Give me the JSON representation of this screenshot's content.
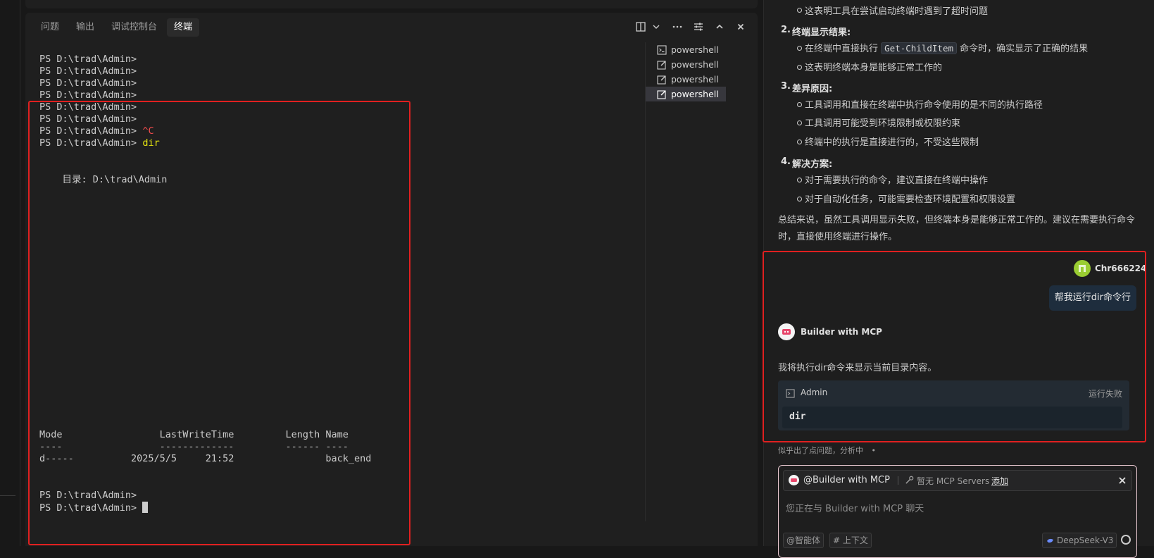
{
  "panel": {
    "tabs": [
      "问题",
      "输出",
      "调试控制台",
      "终端"
    ],
    "active_tab": "终端"
  },
  "terminal": {
    "lines": [
      "PS D:\\trad\\Admin>",
      "PS D:\\trad\\Admin>",
      "PS D:\\trad\\Admin>",
      "PS D:\\trad\\Admin>",
      "PS D:\\trad\\Admin>",
      "PS D:\\trad\\Admin>"
    ],
    "prompt": "PS D:\\trad\\Admin>",
    "ctrl_c": "^C",
    "dir_cmd": "dir",
    "directory_line": "    目录: D:\\trad\\Admin",
    "header": "Mode                 LastWriteTime         Length Name",
    "separator": "----                 -------------         ------ ----",
    "row": "d-----          2025/5/5     21:52                back_end",
    "final_prompts": [
      "PS D:\\trad\\Admin>",
      "PS D:\\trad\\Admin>"
    ]
  },
  "terminal_list": [
    "powershell",
    "powershell",
    "powershell",
    "powershell"
  ],
  "chat": {
    "prev_bullet_1": "这表明工具在尝试启动终端时遇到了超时问题",
    "section2_num": "2.",
    "section2_title": "终端显示结果:",
    "s2_b1_pre": "在终端中直接执行",
    "s2_b1_code": "Get-ChildItem",
    "s2_b1_post": "命令时，确实显示了正确的结果",
    "s2_b2": "这表明终端本身是能够正常工作的",
    "section3_num": "3.",
    "section3_title": "差异原因:",
    "s3_b1": "工具调用和直接在终端中执行命令使用的是不同的执行路径",
    "s3_b2": "工具调用可能受到环境限制或权限约束",
    "s3_b3": "终端中的执行是直接进行的，不受这些限制",
    "section4_num": "4.",
    "section4_title": "解决方案:",
    "s4_b1": "对于需要执行的命令，建议直接在终端中操作",
    "s4_b2": "对于自动化任务，可能需要检查环境配置和权限设置",
    "summary_1": "总结来说，虽然工具调用显示失败，但终端本身是能够正常工作的。建议在需要执行命令",
    "summary_2": "时，直接使用终端进行操作。",
    "user_name": "Chr666224",
    "user_message": "帮我运行dir命令行",
    "bot_name": "Builder with MCP",
    "bot_message": "我将执行dir命令来显示当前目录内容。",
    "card_title": "Admin",
    "card_status": "运行失败",
    "card_command": "dir",
    "analyzing": "似乎出了点问题，分析中",
    "analyzing_dot": "•",
    "input": {
      "agent_tag": "@Builder with MCP",
      "mcp_text": "暂无 MCP Servers",
      "add_link": "添加",
      "placeholder": "您正在与 Builder with MCP 聊天",
      "chip_agent": "@智能体",
      "chip_context": "# 上下文",
      "model": "DeepSeek-V3"
    }
  },
  "colors": {
    "highlight_box": "#e02020",
    "terminal_yellow": "#e5e510",
    "terminal_red": "#f14c4c",
    "status_fail": "#9d9d9d"
  }
}
